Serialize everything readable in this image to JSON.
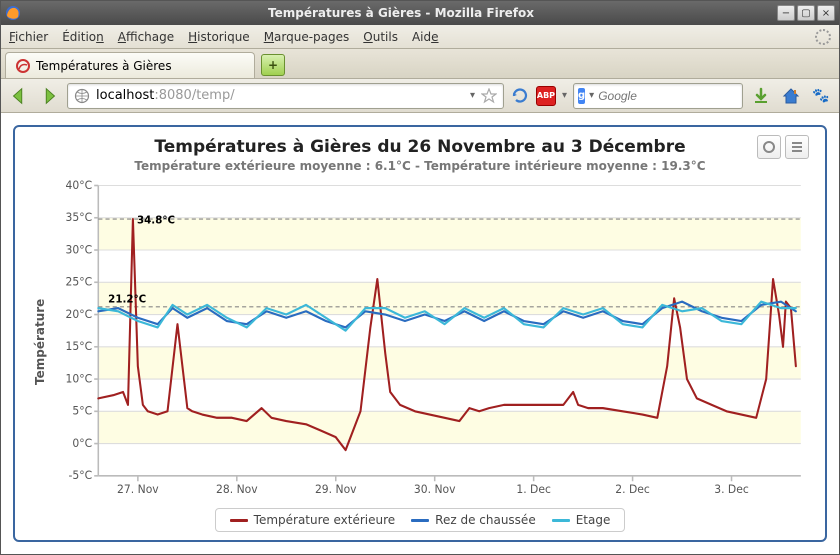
{
  "window": {
    "title": "Températures à Gières - Mozilla Firefox"
  },
  "menubar": {
    "file": "Fichier",
    "edit": "Édition",
    "view": "Affichage",
    "history": "Historique",
    "bookmarks": "Marque-pages",
    "tools": "Outils",
    "help": "Aide"
  },
  "tabs": {
    "tab1": "Températures à Gières"
  },
  "urlbar": {
    "host": "localhost",
    "port": ":8080",
    "path": "/temp/"
  },
  "searchbox": {
    "placeholder": "Google",
    "engine_letter": "g"
  },
  "abp_label": "ABP",
  "chart": {
    "title": "Températures à Gières du 26 Novembre au 3 Décembre",
    "subtitle": "Température extérieure moyenne : 6.1°C - Température intérieure moyenne : 19.3°C",
    "ylabel": "Température",
    "legend": {
      "ext": "Température extérieure",
      "rdc": "Rez de chaussée",
      "etage": "Etage"
    },
    "annot": {
      "peak": "34.8°C",
      "ref": "21.2°C"
    }
  },
  "chart_data": {
    "type": "line",
    "xlabel": "",
    "ylabel": "Température",
    "ylim": [
      -5,
      40
    ],
    "yticks": [
      -5,
      0,
      5,
      10,
      15,
      20,
      25,
      30,
      35,
      40
    ],
    "ytick_labels": [
      "-5°C",
      "0°C",
      "5°C",
      "10°C",
      "15°C",
      "20°C",
      "25°C",
      "30°C",
      "35°C",
      "40°C"
    ],
    "x_categories": [
      "27. Nov",
      "28. Nov",
      "29. Nov",
      "30. Nov",
      "1. Dec",
      "2. Dec",
      "3. Dec"
    ],
    "x_positions_days": [
      1,
      2,
      3,
      4,
      5,
      6,
      7
    ],
    "x_range_days": [
      0.6,
      7.7
    ],
    "reference_lines": [
      {
        "y": 21.2,
        "label": "21.2°C"
      },
      {
        "y": 34.8,
        "label": "34.8°C"
      }
    ],
    "colors": {
      "ext": "#a02020",
      "rdc": "#2a6cc0",
      "etage": "#3cb8d8"
    },
    "series": [
      {
        "name": "Température extérieure",
        "key": "ext",
        "points": [
          [
            0.6,
            7
          ],
          [
            0.75,
            7.5
          ],
          [
            0.85,
            8
          ],
          [
            0.9,
            6
          ],
          [
            0.95,
            34.8
          ],
          [
            1.0,
            12
          ],
          [
            1.05,
            6
          ],
          [
            1.1,
            5
          ],
          [
            1.2,
            4.5
          ],
          [
            1.3,
            5
          ],
          [
            1.4,
            18.5
          ],
          [
            1.45,
            12
          ],
          [
            1.5,
            5.5
          ],
          [
            1.55,
            5
          ],
          [
            1.65,
            4.5
          ],
          [
            1.8,
            4
          ],
          [
            1.95,
            4
          ],
          [
            2.1,
            3.5
          ],
          [
            2.25,
            5.5
          ],
          [
            2.35,
            4
          ],
          [
            2.5,
            3.5
          ],
          [
            2.7,
            3
          ],
          [
            2.85,
            2
          ],
          [
            3.0,
            1
          ],
          [
            3.1,
            -1
          ],
          [
            3.25,
            5
          ],
          [
            3.35,
            18
          ],
          [
            3.42,
            25.5
          ],
          [
            3.5,
            14
          ],
          [
            3.55,
            8
          ],
          [
            3.65,
            6
          ],
          [
            3.8,
            5
          ],
          [
            3.95,
            4.5
          ],
          [
            4.1,
            4
          ],
          [
            4.25,
            3.5
          ],
          [
            4.35,
            5.5
          ],
          [
            4.45,
            5
          ],
          [
            4.55,
            5.5
          ],
          [
            4.7,
            6
          ],
          [
            5.0,
            6
          ],
          [
            5.3,
            6
          ],
          [
            5.4,
            8
          ],
          [
            5.45,
            6
          ],
          [
            5.55,
            5.5
          ],
          [
            5.7,
            5.5
          ],
          [
            5.9,
            5
          ],
          [
            6.1,
            4.5
          ],
          [
            6.25,
            4
          ],
          [
            6.35,
            12
          ],
          [
            6.42,
            22.5
          ],
          [
            6.48,
            18
          ],
          [
            6.55,
            10
          ],
          [
            6.65,
            7
          ],
          [
            6.8,
            6
          ],
          [
            6.95,
            5
          ],
          [
            7.1,
            4.5
          ],
          [
            7.25,
            4
          ],
          [
            7.35,
            10
          ],
          [
            7.42,
            25.5
          ],
          [
            7.48,
            20
          ],
          [
            7.52,
            15
          ],
          [
            7.55,
            22
          ],
          [
            7.6,
            21
          ],
          [
            7.65,
            12
          ]
        ]
      },
      {
        "name": "Rez de chaussée",
        "key": "rdc",
        "points": [
          [
            0.6,
            20.5
          ],
          [
            0.8,
            21
          ],
          [
            1.0,
            19.5
          ],
          [
            1.2,
            18.5
          ],
          [
            1.35,
            21
          ],
          [
            1.5,
            19.5
          ],
          [
            1.7,
            21
          ],
          [
            1.9,
            19
          ],
          [
            2.1,
            18.5
          ],
          [
            2.3,
            20.5
          ],
          [
            2.5,
            19.5
          ],
          [
            2.7,
            20.5
          ],
          [
            2.9,
            19
          ],
          [
            3.1,
            18
          ],
          [
            3.3,
            20.5
          ],
          [
            3.5,
            20
          ],
          [
            3.7,
            19
          ],
          [
            3.9,
            20
          ],
          [
            4.1,
            19
          ],
          [
            4.3,
            20.5
          ],
          [
            4.5,
            19
          ],
          [
            4.7,
            20.5
          ],
          [
            4.9,
            19
          ],
          [
            5.1,
            18.5
          ],
          [
            5.3,
            20.5
          ],
          [
            5.5,
            19.5
          ],
          [
            5.7,
            20.5
          ],
          [
            5.9,
            19
          ],
          [
            6.1,
            18.5
          ],
          [
            6.3,
            21
          ],
          [
            6.5,
            22
          ],
          [
            6.7,
            20.5
          ],
          [
            6.9,
            19.5
          ],
          [
            7.1,
            19
          ],
          [
            7.3,
            21.5
          ],
          [
            7.5,
            22
          ],
          [
            7.65,
            20.5
          ]
        ]
      },
      {
        "name": "Etage",
        "key": "etage",
        "points": [
          [
            0.6,
            21
          ],
          [
            0.8,
            20.5
          ],
          [
            1.0,
            19
          ],
          [
            1.2,
            18
          ],
          [
            1.35,
            21.5
          ],
          [
            1.5,
            20
          ],
          [
            1.7,
            21.5
          ],
          [
            1.9,
            19.5
          ],
          [
            2.1,
            18
          ],
          [
            2.3,
            21
          ],
          [
            2.5,
            20
          ],
          [
            2.7,
            21.5
          ],
          [
            2.9,
            19.5
          ],
          [
            3.1,
            17.5
          ],
          [
            3.3,
            21
          ],
          [
            3.5,
            21
          ],
          [
            3.7,
            19.5
          ],
          [
            3.9,
            20.5
          ],
          [
            4.1,
            18.5
          ],
          [
            4.3,
            21
          ],
          [
            4.5,
            19.5
          ],
          [
            4.7,
            21
          ],
          [
            4.9,
            18.5
          ],
          [
            5.1,
            18
          ],
          [
            5.3,
            21
          ],
          [
            5.5,
            20
          ],
          [
            5.7,
            21
          ],
          [
            5.9,
            18.5
          ],
          [
            6.1,
            18
          ],
          [
            6.3,
            21.5
          ],
          [
            6.5,
            20.5
          ],
          [
            6.7,
            21
          ],
          [
            6.9,
            19
          ],
          [
            7.1,
            18.5
          ],
          [
            7.3,
            22
          ],
          [
            7.5,
            21
          ],
          [
            7.65,
            21
          ]
        ]
      }
    ]
  }
}
